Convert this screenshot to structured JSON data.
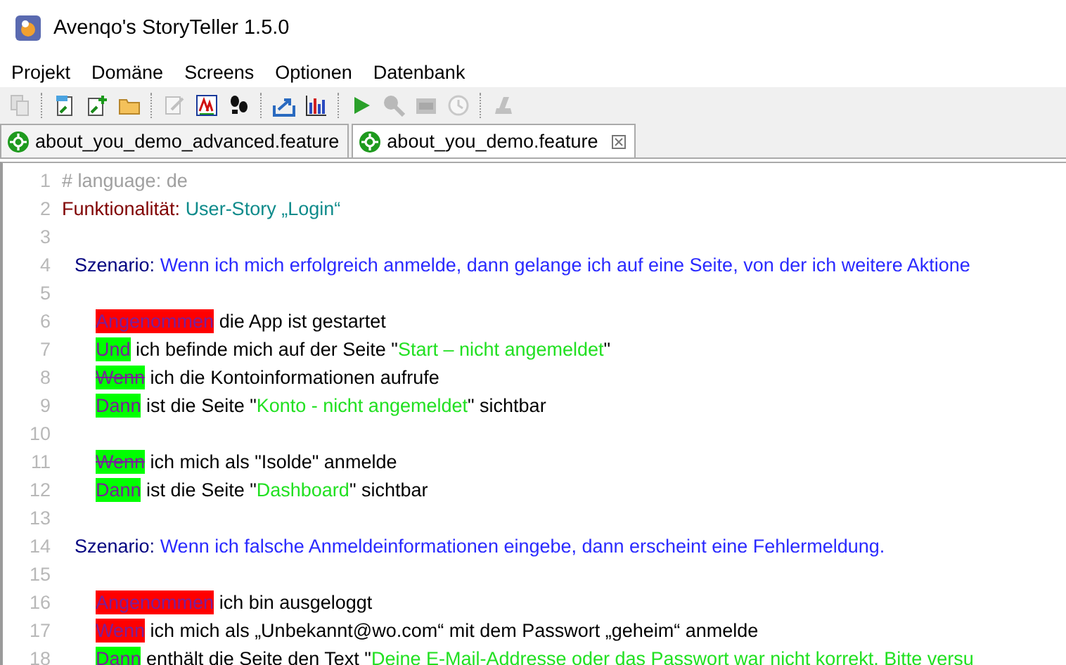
{
  "window": {
    "title": "Avenqo's StoryTeller 1.5.0"
  },
  "menu": [
    "Projekt",
    "Domäne",
    "Screens",
    "Optionen",
    "Datenbank"
  ],
  "toolbar": [
    {
      "kind": "copy",
      "disabled": true
    },
    {
      "kind": "sep"
    },
    {
      "kind": "new-file",
      "disabled": false
    },
    {
      "kind": "add-file",
      "disabled": false
    },
    {
      "kind": "folder",
      "disabled": false
    },
    {
      "kind": "sep"
    },
    {
      "kind": "edit",
      "disabled": true
    },
    {
      "kind": "text-style",
      "disabled": false
    },
    {
      "kind": "footprints",
      "disabled": false
    },
    {
      "kind": "sep"
    },
    {
      "kind": "export",
      "disabled": false
    },
    {
      "kind": "chart",
      "disabled": false
    },
    {
      "kind": "sep"
    },
    {
      "kind": "play",
      "disabled": false
    },
    {
      "kind": "search",
      "disabled": true
    },
    {
      "kind": "print",
      "disabled": true
    },
    {
      "kind": "clock",
      "disabled": true
    },
    {
      "kind": "sep"
    },
    {
      "kind": "stamp",
      "disabled": true
    }
  ],
  "tabs": [
    {
      "label": "about_you_demo_advanced.feature",
      "selected": false
    },
    {
      "label": "about_you_demo.feature",
      "selected": true
    }
  ],
  "editor": {
    "lines": [
      {
        "number": "1",
        "kind": "comment",
        "segments": [
          {
            "kind": "comment",
            "text": "# language: de"
          }
        ]
      },
      {
        "number": "2",
        "kind": "feature",
        "segments": [
          {
            "kind": "keyword",
            "text": "Funktionalität:"
          },
          {
            "kind": "title",
            "text": "User-Story „Login“"
          }
        ]
      },
      {
        "number": "3",
        "kind": "blank"
      },
      {
        "number": "4",
        "kind": "scenario",
        "segments": [
          {
            "kind": "keyword",
            "text": "Szenario:"
          },
          {
            "kind": "title",
            "text": "Wenn ich mich erfolgreich anmelde, dann gelange ich auf eine Seite, von der ich weitere Aktione"
          }
        ]
      },
      {
        "number": "5",
        "kind": "blank"
      },
      {
        "number": "6",
        "kind": "step",
        "segments": [
          {
            "kind": "step",
            "text": "Angenommen",
            "color": "#ff0000",
            "struck": false
          },
          {
            "kind": "plain",
            "text": "die App ist gestartet"
          }
        ]
      },
      {
        "number": "7",
        "kind": "step",
        "segments": [
          {
            "kind": "step",
            "text": "Und",
            "color": "#00ff00",
            "struck": false
          },
          {
            "kind": "plain",
            "text": "ich befinde mich auf der Seite \""
          },
          {
            "kind": "string",
            "text": "Start – nicht angemeldet"
          },
          {
            "kind": "plain",
            "text": "\""
          }
        ]
      },
      {
        "number": "8",
        "kind": "step",
        "segments": [
          {
            "kind": "step",
            "text": "Wenn",
            "color": "#00ff00",
            "struck": true
          },
          {
            "kind": "plain",
            "text": "ich die Kontoinformationen aufrufe"
          }
        ]
      },
      {
        "number": "9",
        "kind": "step",
        "segments": [
          {
            "kind": "step",
            "text": "Dann",
            "color": "#00ff00",
            "struck": false
          },
          {
            "kind": "plain",
            "text": "ist die Seite \""
          },
          {
            "kind": "string",
            "text": "Konto - nicht angemeldet"
          },
          {
            "kind": "plain",
            "text": "\" sichtbar"
          }
        ]
      },
      {
        "number": "10",
        "kind": "blank"
      },
      {
        "number": "11",
        "kind": "step",
        "segments": [
          {
            "kind": "step",
            "text": "Wenn",
            "color": "#00ff00",
            "struck": true
          },
          {
            "kind": "plain",
            "text": "ich mich als \"Isolde\" anmelde"
          }
        ]
      },
      {
        "number": "12",
        "kind": "step",
        "segments": [
          {
            "kind": "step",
            "text": "Dann",
            "color": "#00ff00",
            "struck": false
          },
          {
            "kind": "plain",
            "text": "ist die Seite \""
          },
          {
            "kind": "string",
            "text": "Dashboard"
          },
          {
            "kind": "plain",
            "text": "\" sichtbar"
          }
        ]
      },
      {
        "number": "13",
        "kind": "blank"
      },
      {
        "number": "14",
        "kind": "scenario",
        "segments": [
          {
            "kind": "keyword",
            "text": "Szenario:"
          },
          {
            "kind": "title",
            "text": "Wenn ich falsche Anmeldeinformationen eingebe, dann erscheint eine Fehlermeldung."
          }
        ]
      },
      {
        "number": "15",
        "kind": "blank"
      },
      {
        "number": "16",
        "kind": "step",
        "segments": [
          {
            "kind": "step",
            "text": "Angenommen",
            "color": "#ff0000",
            "struck": false
          },
          {
            "kind": "plain",
            "text": "ich bin ausgeloggt"
          }
        ]
      },
      {
        "number": "17",
        "kind": "step",
        "segments": [
          {
            "kind": "step",
            "text": "Wenn",
            "color": "#ff0000",
            "struck": false
          },
          {
            "kind": "plain",
            "text": "ich mich als „Unbekannt@wo.com“ mit dem Passwort „geheim“ anmelde"
          }
        ]
      },
      {
        "number": "18",
        "kind": "step",
        "segments": [
          {
            "kind": "step",
            "text": "Dann",
            "color": "#00ff00",
            "struck": false
          },
          {
            "kind": "plain",
            "text": "enthält die Seite den Text \""
          },
          {
            "kind": "string",
            "text": "Deine E-Mail-Addresse oder das Passwort war nicht korrekt. Bitte versu"
          }
        ]
      }
    ]
  }
}
